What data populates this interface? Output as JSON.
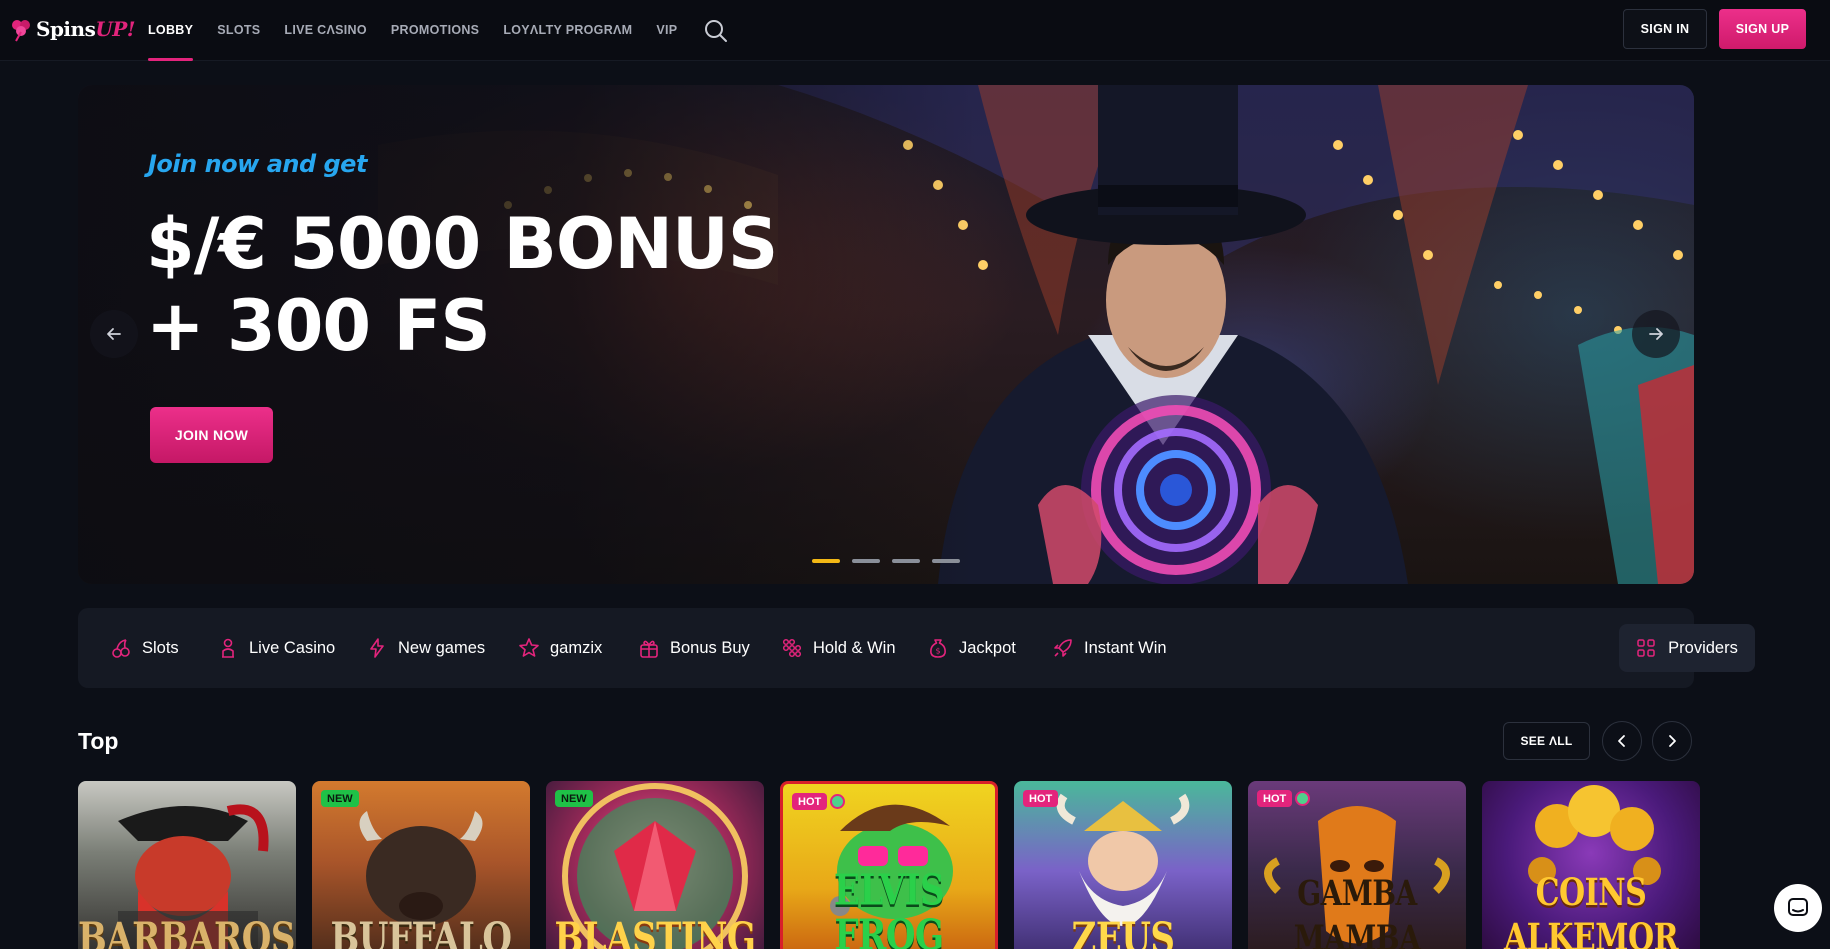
{
  "brand": {
    "name_a": "Spins",
    "name_b": "UP!",
    "accent": "#e3247c"
  },
  "nav": [
    {
      "label": "LOBBY",
      "active": true
    },
    {
      "label": "SLOTS"
    },
    {
      "label": "LIVE CΛSINO"
    },
    {
      "label": "PROMOTIONS"
    },
    {
      "label": "LOYΛLTY PROGRΛM"
    },
    {
      "label": "VIP"
    }
  ],
  "auth": {
    "signin": "SIGN IN",
    "signup": "SIGN UP"
  },
  "hero": {
    "kicker": "Join now and get",
    "line1": "$/€ 5000 BONUS",
    "line2": "+ 300 FS",
    "cta": "JOIN NOW",
    "slide_count": 4,
    "active_slide": 1
  },
  "categories": [
    {
      "label": "Slots",
      "icon": "cherry-icon"
    },
    {
      "label": "Live Casino",
      "icon": "dealer-icon"
    },
    {
      "label": "New games",
      "icon": "lightning-icon"
    },
    {
      "label": "gamzix",
      "icon": "star-icon"
    },
    {
      "label": "Bonus Buy",
      "icon": "gift-icon"
    },
    {
      "label": "Hold & Win",
      "icon": "grid-dots-icon"
    },
    {
      "label": "Jackpot",
      "icon": "money-bag-icon"
    },
    {
      "label": "Instant Win",
      "icon": "rocket-icon"
    }
  ],
  "providers": {
    "label": "Providers",
    "icon": "grid-icon"
  },
  "top": {
    "title": "Top",
    "see_all": "SEE ΛLL",
    "games": [
      {
        "title": "BARBAROSSA",
        "badge": ""
      },
      {
        "title": "BUFFALO",
        "badge": "NEW"
      },
      {
        "title": "BLASTING",
        "badge": "NEW"
      },
      {
        "title": "ELVIS FROG",
        "badge": "HOT",
        "exclusive": true
      },
      {
        "title": "ZEUS",
        "badge": "HOT"
      },
      {
        "title": "GAMBA MAMBA",
        "badge": "HOT",
        "exclusive": true
      },
      {
        "title": "COINS ALKEMOR",
        "badge": ""
      }
    ]
  },
  "colors": {
    "hero_kicker": "#27a6ef",
    "dot_active": "#f3b815",
    "badge_new": "#1fc147",
    "badge_hot": "#e3247c"
  }
}
